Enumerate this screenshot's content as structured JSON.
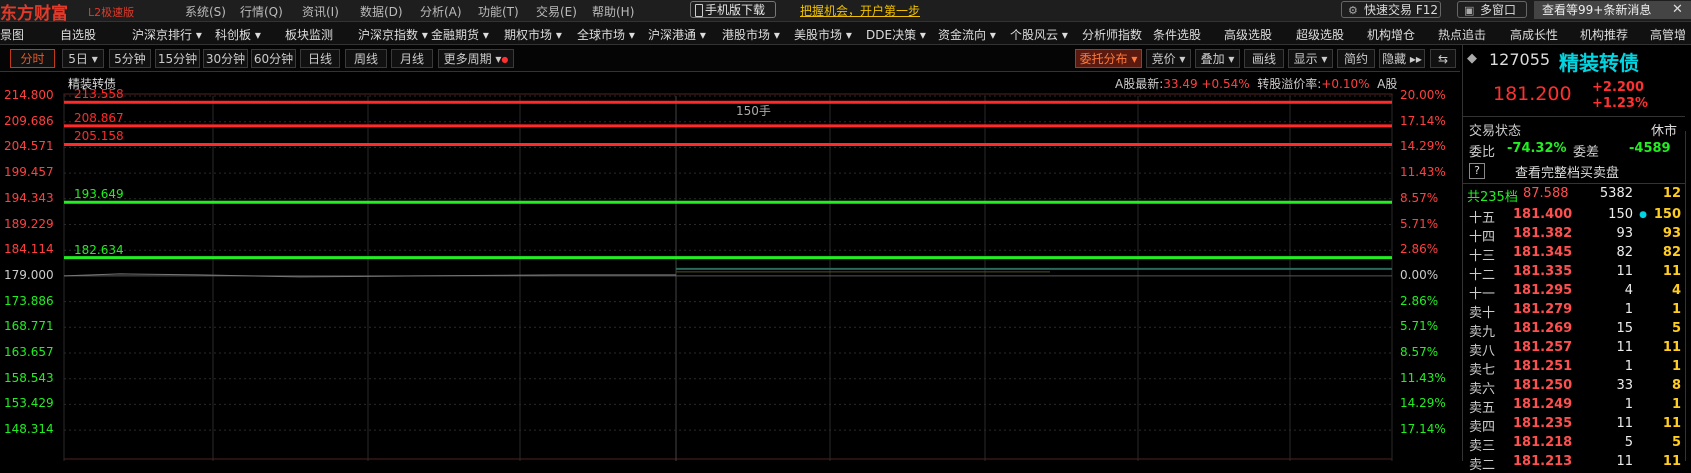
{
  "titlebar": {
    "logo": "东方财富",
    "logo_sub": "L2极速版",
    "menus": [
      "系统(S)",
      "行情(Q)",
      "资讯(I)",
      "数据(D)",
      "分析(A)",
      "功能(T)",
      "交易(E)",
      "帮助(H)"
    ],
    "mobile_label": "手机版下载",
    "promo": "把握机会，开户第一步",
    "quick_trade": "快速交易 F12",
    "multi_window": "多窗口",
    "messages": "查看等99+条新消息"
  },
  "nav": [
    "景图",
    "自选股",
    "沪深京排行 ▾",
    "科创板 ▾",
    "板块监测",
    "沪深京指数 ▾",
    "金融期货 ▾",
    "期权市场 ▾",
    "全球市场 ▾",
    "沪深港通 ▾",
    "港股市场 ▾",
    "美股市场 ▾",
    "DDE决策 ▾",
    "资金流向 ▾",
    "个股风云 ▾",
    "分析师指数",
    "条件选股",
    "高级选股",
    "超级选股",
    "机构增仓",
    "热点追击",
    "高成长性",
    "机构推荐",
    "高管增"
  ],
  "toolbar": {
    "periods": [
      "分时",
      "5日 ▾",
      "5分钟",
      "15分钟",
      "30分钟",
      "60分钟",
      "日线",
      "周线",
      "月线",
      "更多周期 ▾"
    ],
    "active_period": "分时",
    "right_buttons": [
      "委托分布 ▾",
      "竞价 ▾",
      "叠加 ▾",
      "画线",
      "显示 ▾",
      "简约",
      "隐藏 ▸▸",
      "⇆"
    ]
  },
  "chart": {
    "stock_name": "精装转债",
    "a_share_latest_label": "A股最新:",
    "a_share_latest": "33.49",
    "a_share_change": "+0.54%",
    "premium_label": "转股溢价率:",
    "premium": "+0.10%",
    "a_tag": "A股",
    "center_label": "150手",
    "y_left": [
      "214.800",
      "209.686",
      "204.571",
      "199.457",
      "194.343",
      "189.229",
      "184.114",
      "179.000",
      "173.886",
      "168.771",
      "163.657",
      "158.543",
      "153.429",
      "148.314"
    ],
    "y_right": [
      "20.00%",
      "17.14%",
      "14.29%",
      "11.43%",
      "8.57%",
      "5.71%",
      "2.86%",
      "0.00%",
      "2.86%",
      "5.71%",
      "8.57%",
      "11.43%",
      "14.29%",
      "17.14%"
    ],
    "order_levels": [
      {
        "price": "213.558",
        "color": "#ff2a2a"
      },
      {
        "price": "208.867",
        "color": "#ff2a2a"
      },
      {
        "price": "205.158",
        "color": "#ff2a2a"
      },
      {
        "price": "193.649",
        "color": "#22ee22"
      },
      {
        "price": "182.634",
        "color": "#22ee22"
      }
    ]
  },
  "quote": {
    "code": "127055",
    "name": "精装转债",
    "price": "181.200",
    "change": "+2.200",
    "change_pct": "+1.23%",
    "status_label": "交易状态",
    "status": "休市",
    "wb_label": "委比",
    "wb": "-74.32%",
    "wc_label": "委差",
    "wc": "-4589",
    "full_depth": "查看完整档买卖盘",
    "total_label": "共235档",
    "total_price": "87.588",
    "total_vol": "5382",
    "total_count": "12",
    "asks": [
      {
        "label": "十五",
        "price": "181.400",
        "vol": "150",
        "cnt": "150",
        "dot": true
      },
      {
        "label": "十四",
        "price": "181.382",
        "vol": "93",
        "cnt": "93"
      },
      {
        "label": "十三",
        "price": "181.345",
        "vol": "82",
        "cnt": "82"
      },
      {
        "label": "十二",
        "price": "181.335",
        "vol": "11",
        "cnt": "11"
      },
      {
        "label": "十一",
        "price": "181.295",
        "vol": "4",
        "cnt": "4"
      },
      {
        "label": "卖十",
        "price": "181.279",
        "vol": "1",
        "cnt": "1"
      },
      {
        "label": "卖九",
        "price": "181.269",
        "vol": "15",
        "cnt": "5"
      },
      {
        "label": "卖八",
        "price": "181.257",
        "vol": "11",
        "cnt": "11"
      },
      {
        "label": "卖七",
        "price": "181.251",
        "vol": "1",
        "cnt": "1"
      },
      {
        "label": "卖六",
        "price": "181.250",
        "vol": "33",
        "cnt": "8"
      },
      {
        "label": "卖五",
        "price": "181.249",
        "vol": "1",
        "cnt": "1"
      },
      {
        "label": "卖四",
        "price": "181.235",
        "vol": "11",
        "cnt": "11"
      },
      {
        "label": "卖三",
        "price": "181.218",
        "vol": "5",
        "cnt": "5"
      },
      {
        "label": "卖二",
        "price": "181.213",
        "vol": "11",
        "cnt": "11"
      }
    ]
  },
  "colors": {
    "up": "#ff3030",
    "down": "#22ee22",
    "accent": "#e05a2a",
    "cyan": "#00d4e0"
  }
}
